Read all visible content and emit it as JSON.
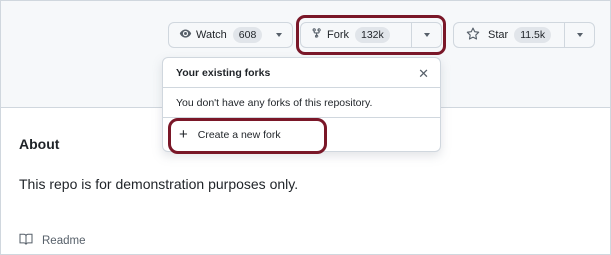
{
  "header": {
    "watch": {
      "label": "Watch",
      "count": "608",
      "icon": "eye-icon"
    },
    "fork": {
      "label": "Fork",
      "count": "132k",
      "icon": "repo-forked-icon"
    },
    "star": {
      "label": "Star",
      "count": "11.5k",
      "icon": "star-icon"
    }
  },
  "fork_popover": {
    "title": "Your existing forks",
    "message": "You don't have any forks of this repository.",
    "action_label": "Create a new fork",
    "close_icon": "close-icon"
  },
  "about": {
    "title": "About",
    "description": "This repo is for demonstration purposes only.",
    "readme_label": "Readme",
    "readme_icon": "book-icon"
  },
  "colors": {
    "highlight": "#7a1728",
    "header_bg": "#f6f8fa",
    "border": "#d0d7de",
    "counter_bg": "#e1e5ea"
  }
}
